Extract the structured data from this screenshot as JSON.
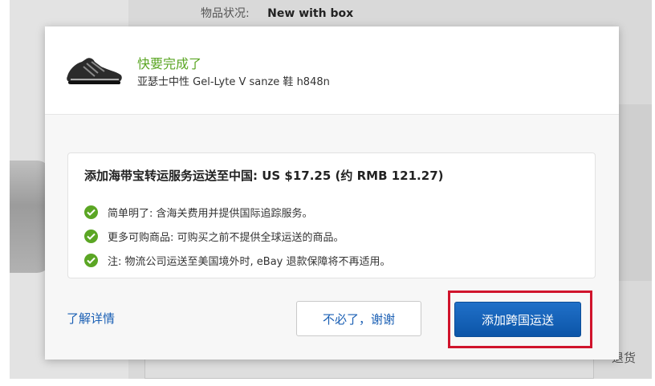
{
  "background": {
    "condition_label": "物品状况:",
    "condition_value": "New with box",
    "return_text": "退货"
  },
  "modal": {
    "header": {
      "title": "快要完成了",
      "product_name": "亚瑟士中性 Gel-Lyte V sanze 鞋 h848n"
    },
    "offer": {
      "title": "添加海带宝转运服务运送至中国: US $17.25  (约 RMB 121.27)",
      "benefits": [
        "简单明了: 含海关费用并提供国际追踪服务。",
        "更多可购商品: 可购买之前不提供全球运送的商品。",
        "注: 物流公司运送至美国境外时, eBay 退款保障将不再适用。"
      ]
    },
    "footer": {
      "learn_more": "了解详情",
      "decline_label": "不必了，谢谢",
      "accept_label": "添加跨国运送"
    }
  },
  "colors": {
    "accent_green": "#5ba624",
    "link_blue": "#1a5fb4",
    "primary_button": "#0c55a8",
    "highlight_red": "#d0142c"
  }
}
